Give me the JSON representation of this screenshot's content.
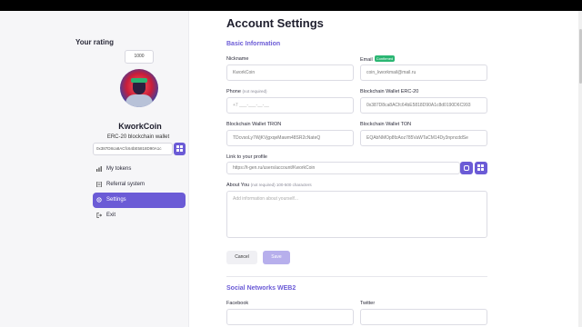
{
  "sidebar": {
    "rating_title": "Your rating",
    "rating_value": "1000",
    "user_name": "KworkCoin",
    "wallet_title": "ERC-20 blockchain wallet",
    "wallet_value": "0x387D8ca8ACfc64bE5818D90A1c",
    "menu": [
      {
        "label": "My tokens",
        "icon": "bars-icon"
      },
      {
        "label": "Referral system",
        "icon": "document-icon"
      },
      {
        "label": "Settings",
        "icon": "gear-icon"
      },
      {
        "label": "Exit",
        "icon": "exit-icon"
      }
    ],
    "active_index": 2
  },
  "main": {
    "title": "Account Settings",
    "basic_section": "Basic Information",
    "nickname": {
      "label": "Nickname",
      "value": "KworkCoin"
    },
    "email": {
      "label": "Email",
      "badge": "Confirmed",
      "value": "coin_kworkmail@mail.ru"
    },
    "phone": {
      "label": "Phone",
      "note": "(not required)",
      "placeholder": "+7 ___-___-__-__"
    },
    "erc20": {
      "label": "Blockchain Wallet ERC-20",
      "value": "0x387D8ca8ACfc64bE5818D90A1c8d0190D6C993"
    },
    "tron": {
      "label": "Blockchain Wallet TRON",
      "value": "TDcvsoLy7WjKVjgxqeMawm48SR2cNateQ"
    },
    "ton": {
      "label": "Blockchain Wallet TON",
      "value": "EQAbNMOp8fzAoz785VaWTaCM14Dy3npncddSe"
    },
    "profile_link": {
      "label": "Link to your profile",
      "value": "https://t-gen.ru/users/account/KworkCoin"
    },
    "about": {
      "label": "About You",
      "note": "(not required) 100-500 characters",
      "placeholder": "Add information about yourself..."
    },
    "cancel_label": "Cancel",
    "save_label": "Save",
    "social_section": "Social Networks WEB2",
    "facebook_label": "Facebook",
    "twitter_label": "Twitter"
  },
  "colors": {
    "accent": "#6b5bd6",
    "confirmed": "#2bb673",
    "save_disabled": "#b7afec"
  }
}
